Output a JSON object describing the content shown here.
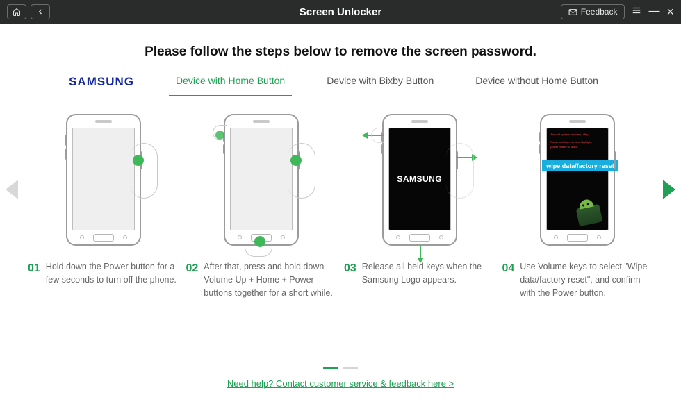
{
  "titlebar": {
    "title": "Screen Unlocker",
    "feedback_label": "Feedback"
  },
  "page": {
    "heading": "Please follow the steps below to remove the screen password."
  },
  "brand": "SAMSUNG",
  "tabs": [
    {
      "label": "Device with Home Button",
      "active": true
    },
    {
      "label": "Device with Bixby Button",
      "active": false
    },
    {
      "label": "Device without Home Button",
      "active": false
    }
  ],
  "steps": [
    {
      "num": "01",
      "text": "Hold down the Power button for a few seconds to turn off the phone."
    },
    {
      "num": "02",
      "text": "After that, press and hold down Volume Up + Home + Power buttons together for a short while."
    },
    {
      "num": "03",
      "text": "Release all held keys when the Samsung Logo appears."
    },
    {
      "num": "04",
      "text": "Use Volume keys to select \"Wipe data/factory reset\", and confirm with the Power button."
    }
  ],
  "illus": {
    "samsung_logo": "SAMSUNG",
    "wipe_label": "wipe data/factory reset"
  },
  "footer": {
    "help_link": "Need help? Contact customer service & feedback here >"
  },
  "icons": {
    "home": "home-icon",
    "back": "back-icon",
    "mail": "mail-icon",
    "menu": "menu-icon",
    "minimize": "minimize-icon",
    "close": "close-icon"
  }
}
